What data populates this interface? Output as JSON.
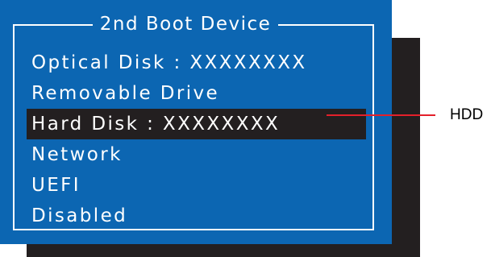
{
  "dialog": {
    "title": "2nd Boot Device",
    "options": [
      {
        "label": "Optical Disk : XXXXXXXX",
        "selected": false
      },
      {
        "label": "Removable Drive",
        "selected": false
      },
      {
        "label": "Hard Disk : XXXXXXXX",
        "selected": true
      },
      {
        "label": "Network",
        "selected": false
      },
      {
        "label": "UEFI",
        "selected": false
      },
      {
        "label": "Disabled",
        "selected": false
      }
    ]
  },
  "callout": {
    "label": "HDD",
    "line_color": "#e4202b"
  },
  "colors": {
    "dialog_background": "#0c66b2",
    "shadow": "#231f20",
    "highlight": "#231f20",
    "text": "#ffffff"
  }
}
